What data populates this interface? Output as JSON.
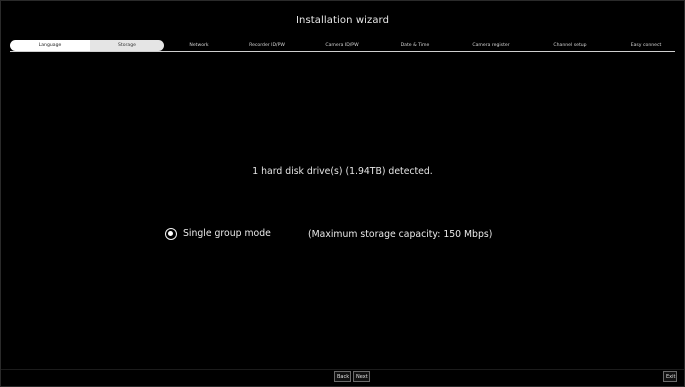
{
  "window": {
    "title": "Installation wizard"
  },
  "steps": [
    {
      "label": "Language",
      "state": "done"
    },
    {
      "label": "Storage",
      "state": "current"
    },
    {
      "label": "Network",
      "state": "pending"
    },
    {
      "label": "Recorder ID/PW",
      "state": "pending"
    },
    {
      "label": "Camera ID/PW",
      "state": "pending"
    },
    {
      "label": "Date & Time",
      "state": "pending"
    },
    {
      "label": "Camera register",
      "state": "pending"
    },
    {
      "label": "Channel setup",
      "state": "pending"
    },
    {
      "label": "Easy connect",
      "state": "pending"
    }
  ],
  "main": {
    "detected_text": "1 hard disk drive(s) (1.94TB) detected.",
    "mode": {
      "label": "Single group mode",
      "selected": true
    },
    "capacity_text": "(Maximum storage capacity: 150 Mbps)"
  },
  "footer": {
    "back_label": "Back",
    "next_label": "Next",
    "exit_label": "Exit"
  },
  "colors": {
    "background": "#000000",
    "text": "#e6e6e6",
    "active_step_bg": "#ffffff"
  }
}
